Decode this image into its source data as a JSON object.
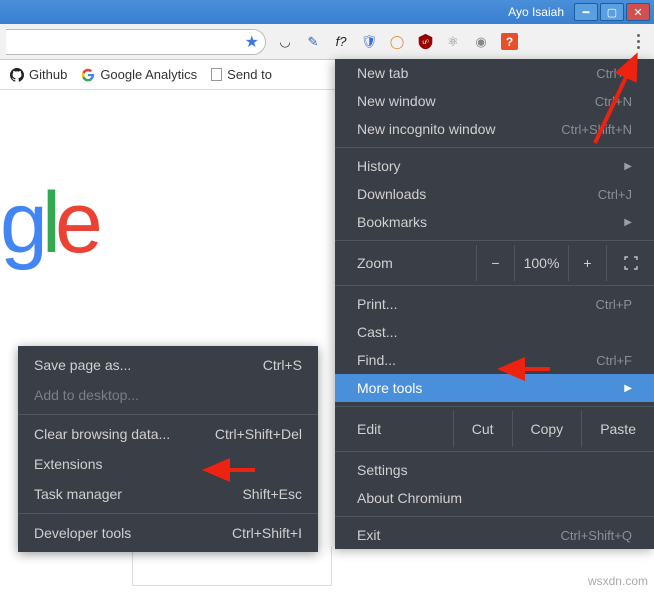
{
  "titlebar": {
    "user": "Ayo Isaiah"
  },
  "bookmarks": {
    "github": "Github",
    "ga": "Google Analytics",
    "sendto": "Send to"
  },
  "google_logo": {
    "g": "g",
    "l": "l",
    "e": "e"
  },
  "menu": {
    "new_tab": "New tab",
    "new_tab_hint": "Ctrl+T",
    "new_window": "New window",
    "new_window_hint": "Ctrl+N",
    "incognito": "New incognito window",
    "incognito_hint": "Ctrl+Shift+N",
    "history": "History",
    "downloads": "Downloads",
    "downloads_hint": "Ctrl+J",
    "bookmarks": "Bookmarks",
    "zoom": "Zoom",
    "zoom_minus": "−",
    "zoom_val": "100%",
    "zoom_plus": "+",
    "print": "Print...",
    "print_hint": "Ctrl+P",
    "cast": "Cast...",
    "find": "Find...",
    "find_hint": "Ctrl+F",
    "more_tools": "More tools",
    "edit": "Edit",
    "cut": "Cut",
    "copy": "Copy",
    "paste": "Paste",
    "settings": "Settings",
    "about": "About Chromium",
    "exit": "Exit",
    "exit_hint": "Ctrl+Shift+Q"
  },
  "submenu": {
    "save": "Save page as...",
    "save_hint": "Ctrl+S",
    "add_desktop": "Add to desktop...",
    "clear": "Clear browsing data...",
    "clear_hint": "Ctrl+Shift+Del",
    "extensions": "Extensions",
    "taskmgr": "Task manager",
    "taskmgr_hint": "Shift+Esc",
    "devtools": "Developer tools",
    "devtools_hint": "Ctrl+Shift+I"
  },
  "watermark": "wsxdn.com"
}
